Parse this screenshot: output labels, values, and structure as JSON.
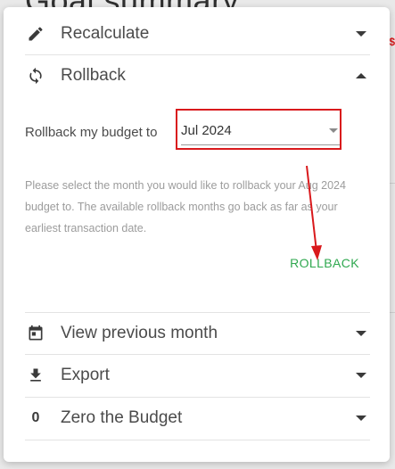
{
  "background": {
    "title": "Goal summary",
    "edge_glyph": "$"
  },
  "panel": {
    "items": [
      {
        "label": "Recalculate",
        "icon": "pencil-icon",
        "chevron": "down"
      },
      {
        "label": "Rollback",
        "icon": "sync-icon",
        "chevron": "up"
      },
      {
        "label": "View previous month",
        "icon": "calendar-icon",
        "chevron": "down"
      },
      {
        "label": "Export",
        "icon": "download-icon",
        "chevron": "down"
      },
      {
        "label": "Zero the Budget",
        "icon": "zero-icon",
        "icon_text": "0",
        "chevron": "down"
      }
    ],
    "rollback": {
      "field_label": "Rollback my budget to",
      "selected_month": "Jul 2024",
      "help_text": "Please select the month you would like to rollback your Aug 2024 budget to. The available rollback months go back as far as your earliest transaction date.",
      "button_label": "ROLLBACK"
    }
  },
  "colors": {
    "annotation_red": "#d9191c",
    "action_green": "#2fa84f",
    "text_primary": "#4b4b4b",
    "text_muted": "#9c9c9c"
  }
}
